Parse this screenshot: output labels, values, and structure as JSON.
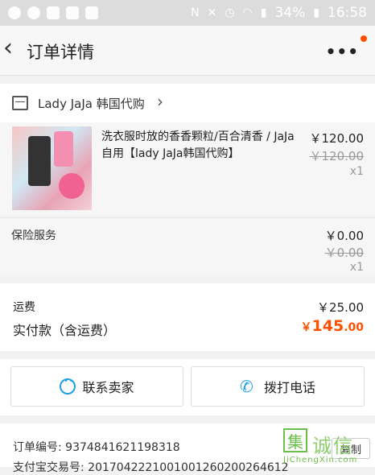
{
  "statusbar": {
    "network": "N",
    "battery": "34%",
    "time": "16:58"
  },
  "navbar": {
    "back_icon": "‹",
    "title": "订单详情",
    "more_icon": "•••"
  },
  "shop": {
    "name": "Lady JaJa 韩国代购",
    "arrow": "›"
  },
  "item": {
    "title": "洗衣服时放的香香颗粒/百合清香 / JaJa自用【lady JaJa韩国代购】",
    "price": "￥120.00",
    "original_price": "￥120.00",
    "qty": "x1"
  },
  "insurance": {
    "label": "保险服务",
    "price": "￥0.00",
    "original_price": "￥0.00",
    "qty": "x1"
  },
  "totals": {
    "shipping_label": "运费",
    "shipping_value": "￥25.00",
    "pay_label": "实付款（含运费）",
    "pay_currency": "￥",
    "pay_main": "145",
    "pay_decimal": ".00"
  },
  "actions": {
    "contact_label": "联系卖家",
    "call_label": "拨打电话"
  },
  "order_info": {
    "order_no": "订单编号: 9374841621198318",
    "trade_no": "支付宝交易号: 2017042221001001260200264612",
    "copy_label": "复制"
  },
  "watermark": {
    "mark": "集",
    "text": "诚信",
    "sub": "JiChengXin.com"
  },
  "colors": {
    "accent": "#ff5000",
    "link_blue": "#1ea0e6"
  }
}
